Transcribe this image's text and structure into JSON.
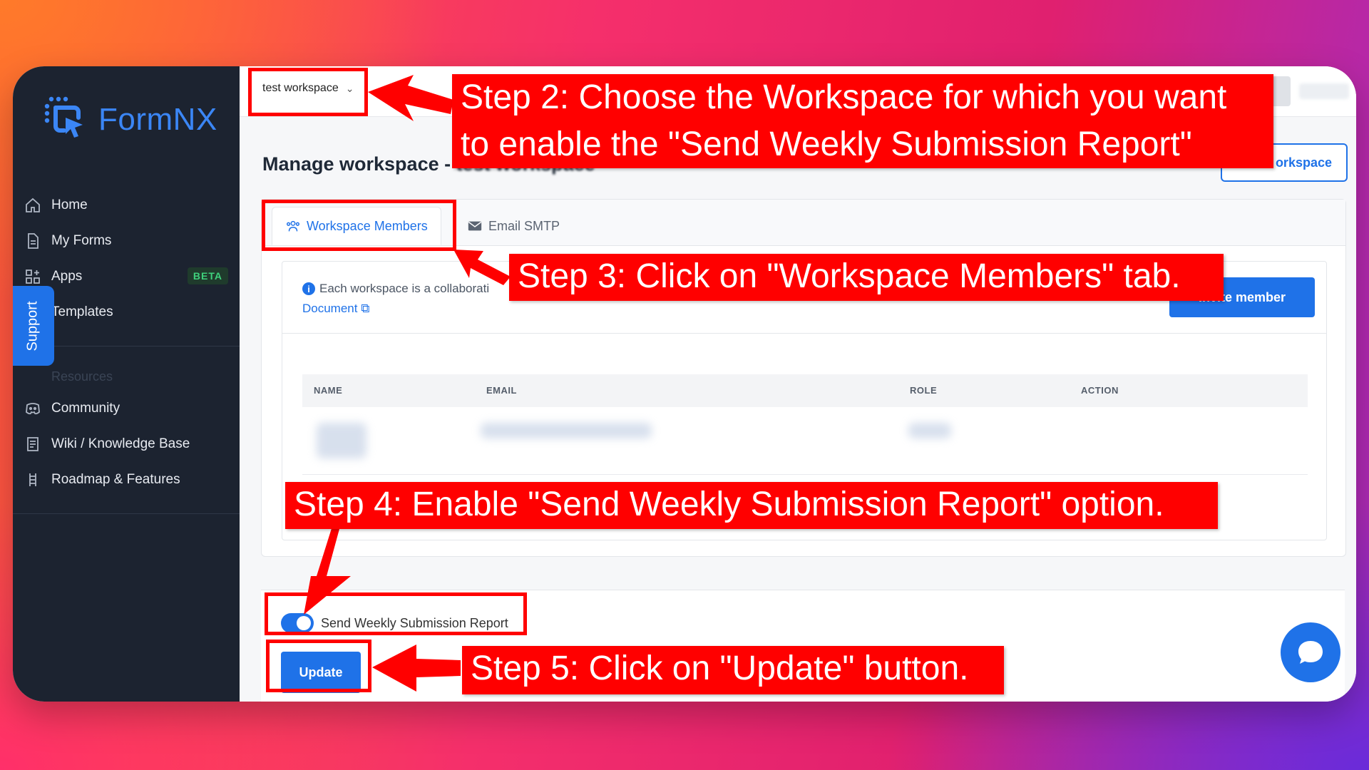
{
  "sidebar": {
    "logo_text": "FormNX",
    "items": [
      {
        "label": "Home",
        "icon": "home-icon"
      },
      {
        "label": "My Forms",
        "icon": "document-icon"
      },
      {
        "label": "Apps",
        "icon": "apps-icon",
        "badge": "BETA"
      },
      {
        "label": "Templates",
        "icon": "template-icon"
      }
    ],
    "section_label": "Resources",
    "resources": [
      {
        "label": "Community",
        "icon": "discord-icon"
      },
      {
        "label": "Wiki / Knowledge Base",
        "icon": "wiki-icon"
      },
      {
        "label": "Roadmap & Features",
        "icon": "roadmap-icon"
      }
    ],
    "support_label": "Support"
  },
  "topbar": {
    "workspace_select": "test workspace"
  },
  "page": {
    "title": "Manage workspace - ",
    "title_suffix": "test workspace",
    "outline_button": "orkspace"
  },
  "tabs": {
    "active": "Workspace Members",
    "inactive": "Email SMTP"
  },
  "members": {
    "info_text": "Each workspace is a collaborati",
    "doc_link": "Document",
    "invite_button": "Invite member",
    "columns": [
      "NAME",
      "EMAIL",
      "ROLE",
      "ACTION"
    ]
  },
  "settings": {
    "toggle_label": "Send Weekly Submission Report",
    "toggle_on": true,
    "update_button": "Update"
  },
  "annotations": {
    "step2": [
      "Step 2: Choose the Workspace for which you want",
      "to enable the \"Send Weekly Submission Report\""
    ],
    "step3": "Step 3: Click on \"Workspace Members\" tab.",
    "step4": "Step 4: Enable \"Send Weekly Submission Report\" option.",
    "step5": "Step 5: Click on \"Update\" button."
  },
  "colors": {
    "accent": "#1f72e8",
    "sidebar_bg": "#1c2330",
    "annotation_red": "#ff0000"
  }
}
